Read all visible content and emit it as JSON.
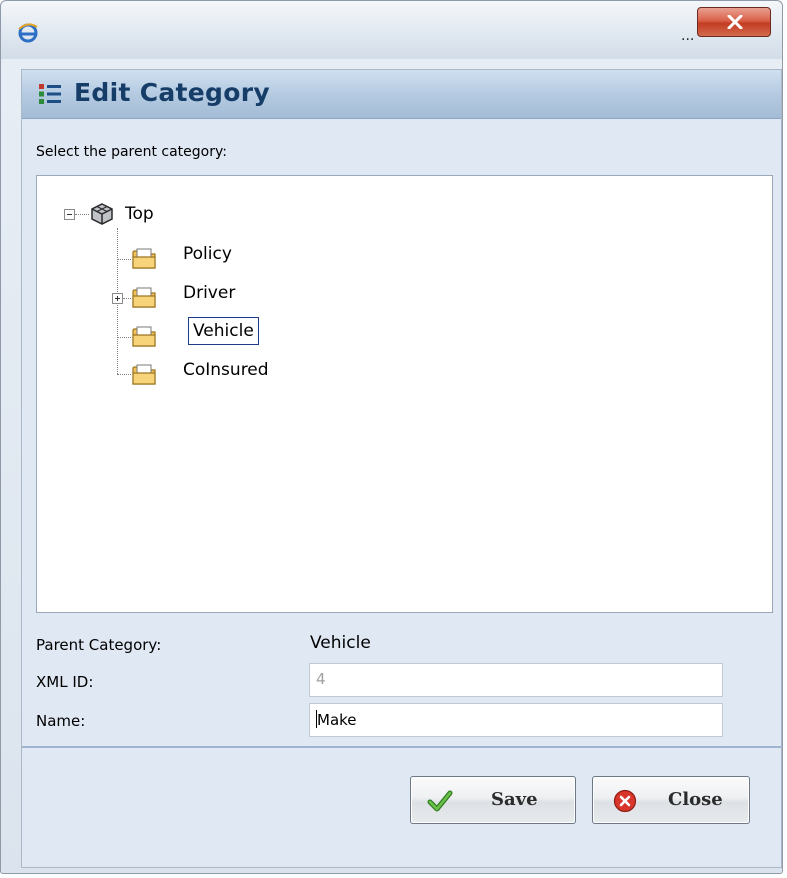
{
  "window": {
    "title_text": "...",
    "browser_icon": "ie-icon",
    "close_icon": "close-x-icon"
  },
  "dialog": {
    "title": "Edit Category",
    "title_icon": "category-list-icon",
    "prompt": "Select the parent category:"
  },
  "tree": {
    "root": {
      "label": "Top",
      "icon": "cube-icon",
      "expanded": true
    },
    "children": [
      {
        "label": "Policy",
        "icon": "folder-icon",
        "has_children": false,
        "selected": false
      },
      {
        "label": "Driver",
        "icon": "folder-icon",
        "has_children": true,
        "expanded": false,
        "selected": false
      },
      {
        "label": "Vehicle",
        "icon": "folder-icon",
        "has_children": false,
        "selected": true
      },
      {
        "label": "CoInsured",
        "icon": "folder-icon",
        "has_children": false,
        "selected": false
      }
    ]
  },
  "form": {
    "parent_category_label": "Parent Category:",
    "parent_category_value": "Vehicle",
    "xml_id_label": "XML ID:",
    "xml_id_value": "4",
    "name_label": "Name:",
    "name_value": "Make"
  },
  "buttons": {
    "save_label": "Save",
    "save_icon": "checkmark-icon",
    "close_label": "Close",
    "close_icon": "close-circle-icon"
  },
  "colors": {
    "header_gradient_top": "#cfdff0",
    "header_title": "#163d68",
    "selection_border": "#1e3c8a",
    "close_button_red": "#c33c23",
    "save_check_green": "#3a9a2a"
  }
}
